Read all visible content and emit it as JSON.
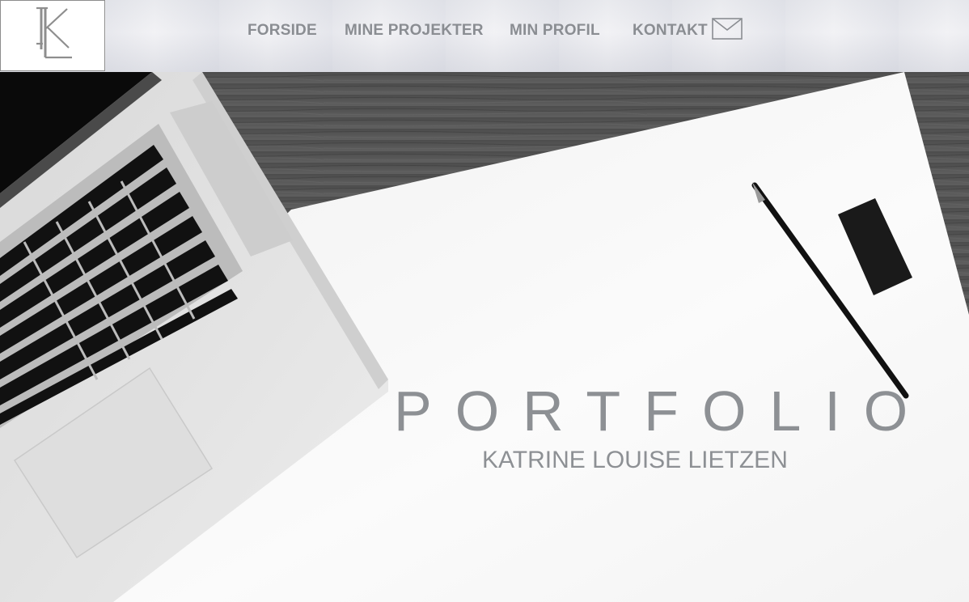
{
  "logo": {
    "letters": "KL"
  },
  "nav": {
    "items": [
      "FORSIDE",
      "MINE PROJEKTER",
      "MIN PROFIL",
      "KONTAKT"
    ],
    "contact_icon": "envelope-icon"
  },
  "hero": {
    "title": "PORTFOLIO",
    "subtitle": "KATRINE LOUISE LIETZEN",
    "image": "desk-with-laptop-paper-pen-eraser"
  },
  "colors": {
    "nav_text": "#8a8d92",
    "hero_text": "#8d9094"
  }
}
